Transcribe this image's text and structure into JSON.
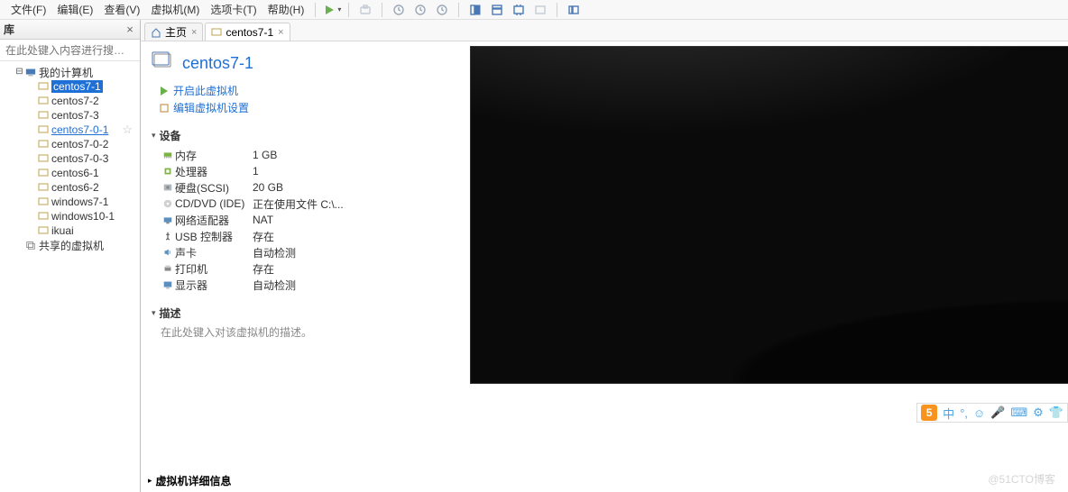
{
  "menu": [
    "文件(F)",
    "编辑(E)",
    "查看(V)",
    "虚拟机(M)",
    "选项卡(T)",
    "帮助(H)"
  ],
  "sidebar": {
    "title": "库",
    "search_placeholder": "在此处键入内容进行搜…",
    "root": "我的计算机",
    "items": [
      "centos7-1",
      "centos7-2",
      "centos7-3",
      "centos7-0-1",
      "centos7-0-2",
      "centos7-0-3",
      "centos6-1",
      "centos6-2",
      "windows7-1",
      "windows10-1",
      "ikuai"
    ],
    "shared": "共享的虚拟机"
  },
  "tabs": {
    "home": "主页",
    "vm": "centos7-1"
  },
  "vm": {
    "title": "centos7-1",
    "power_on": "开启此虚拟机",
    "edit_settings": "编辑虚拟机设置",
    "sections": {
      "devices": "设备",
      "description": "描述",
      "details": "虚拟机详细信息"
    },
    "devices": [
      {
        "icon": "memory",
        "name": "内存",
        "value": "1 GB"
      },
      {
        "icon": "cpu",
        "name": "处理器",
        "value": "1"
      },
      {
        "icon": "disk",
        "name": "硬盘(SCSI)",
        "value": "20 GB"
      },
      {
        "icon": "cd",
        "name": "CD/DVD (IDE)",
        "value": "正在使用文件 C:\\..."
      },
      {
        "icon": "net",
        "name": "网络适配器",
        "value": "NAT"
      },
      {
        "icon": "usb",
        "name": "USB 控制器",
        "value": "存在"
      },
      {
        "icon": "sound",
        "name": "声卡",
        "value": "自动检测"
      },
      {
        "icon": "printer",
        "name": "打印机",
        "value": "存在"
      },
      {
        "icon": "display",
        "name": "显示器",
        "value": "自动检测"
      }
    ],
    "description_placeholder": "在此处键入对该虚拟机的描述。"
  },
  "watermark": "@51CTO博客",
  "floatbar": {
    "badge": "5",
    "lang": "中"
  }
}
